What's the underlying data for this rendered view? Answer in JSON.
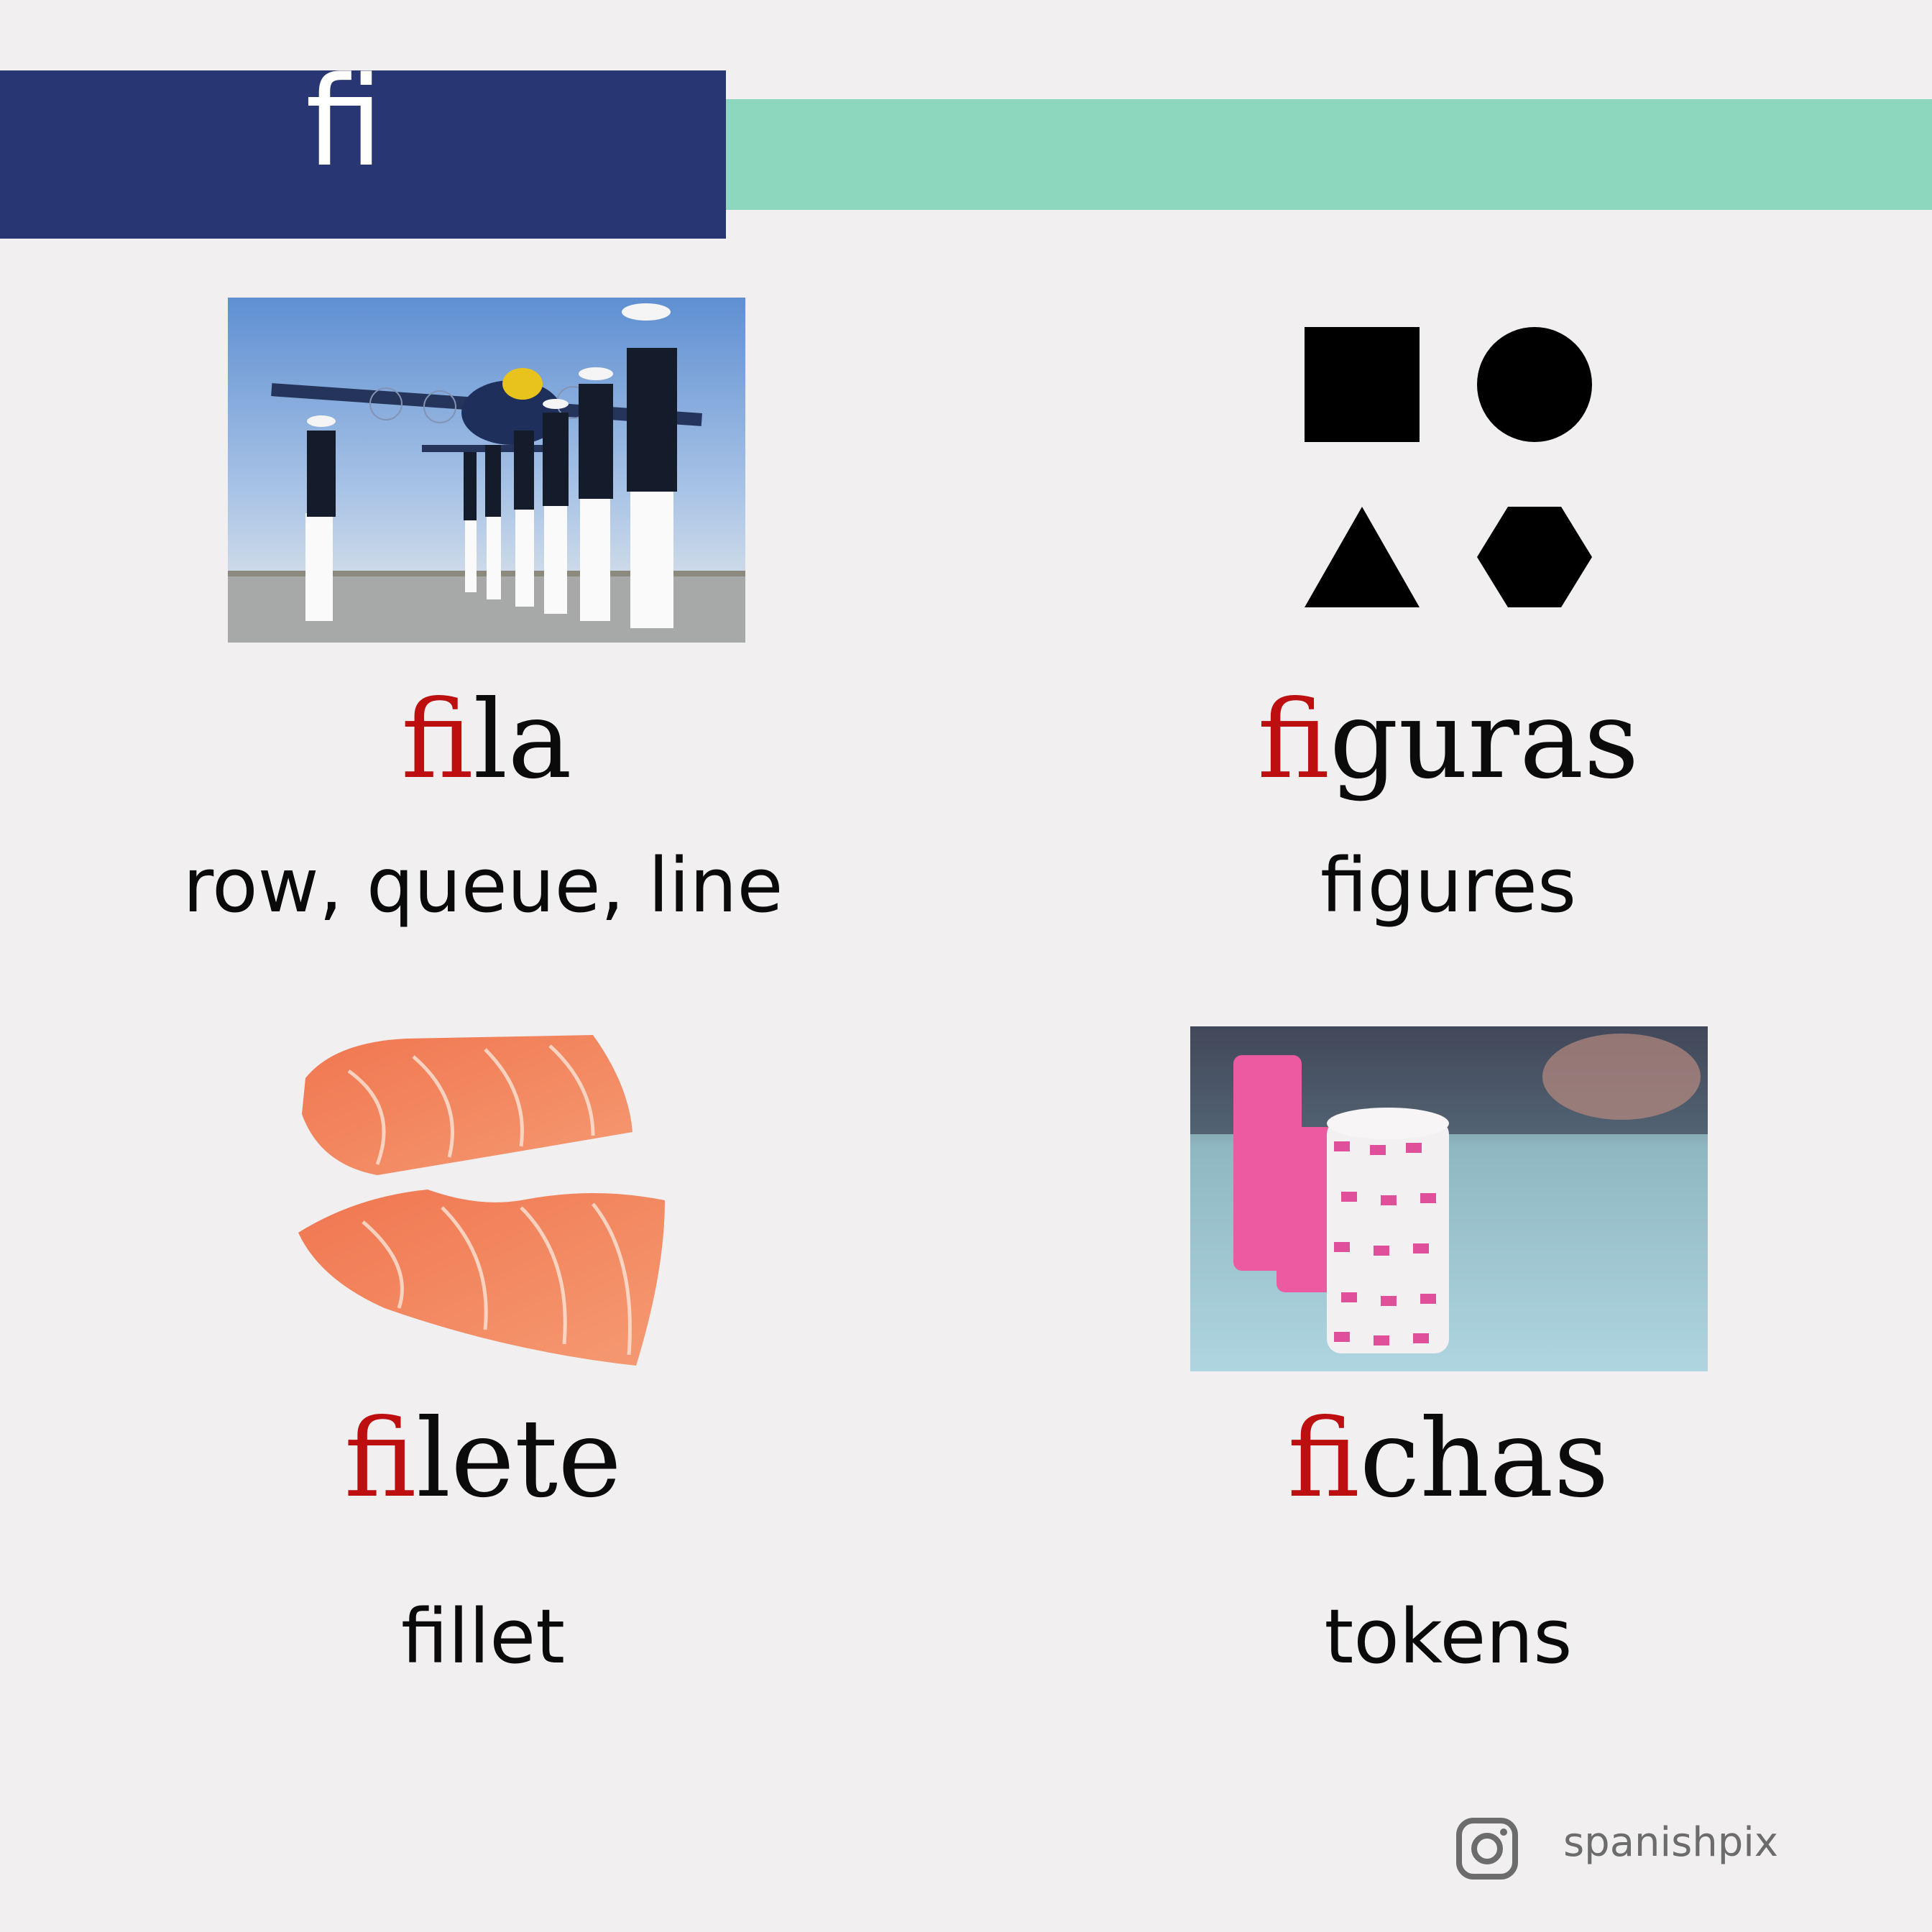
{
  "header": {
    "syllable": "fi",
    "bar_color": "#283673",
    "accent_color": "#8cd7bd"
  },
  "highlight_color": "#bd0e10",
  "cards": [
    {
      "highlight": "fi",
      "rest": "la",
      "translation": "row, queue, line",
      "image": "marines-in-row-photo"
    },
    {
      "highlight": "fi",
      "rest": "guras",
      "translation": "figures",
      "image": "geometric-shapes-icon"
    },
    {
      "highlight": "fi",
      "rest": "lete",
      "translation": "fillet",
      "image": "salmon-fillet-photo"
    },
    {
      "highlight": "fi",
      "rest": "chas",
      "translation": "tokens",
      "image": "poker-chips-photo"
    }
  ],
  "footer": {
    "social_icon": "instagram-icon",
    "handle": "spanishpix"
  }
}
